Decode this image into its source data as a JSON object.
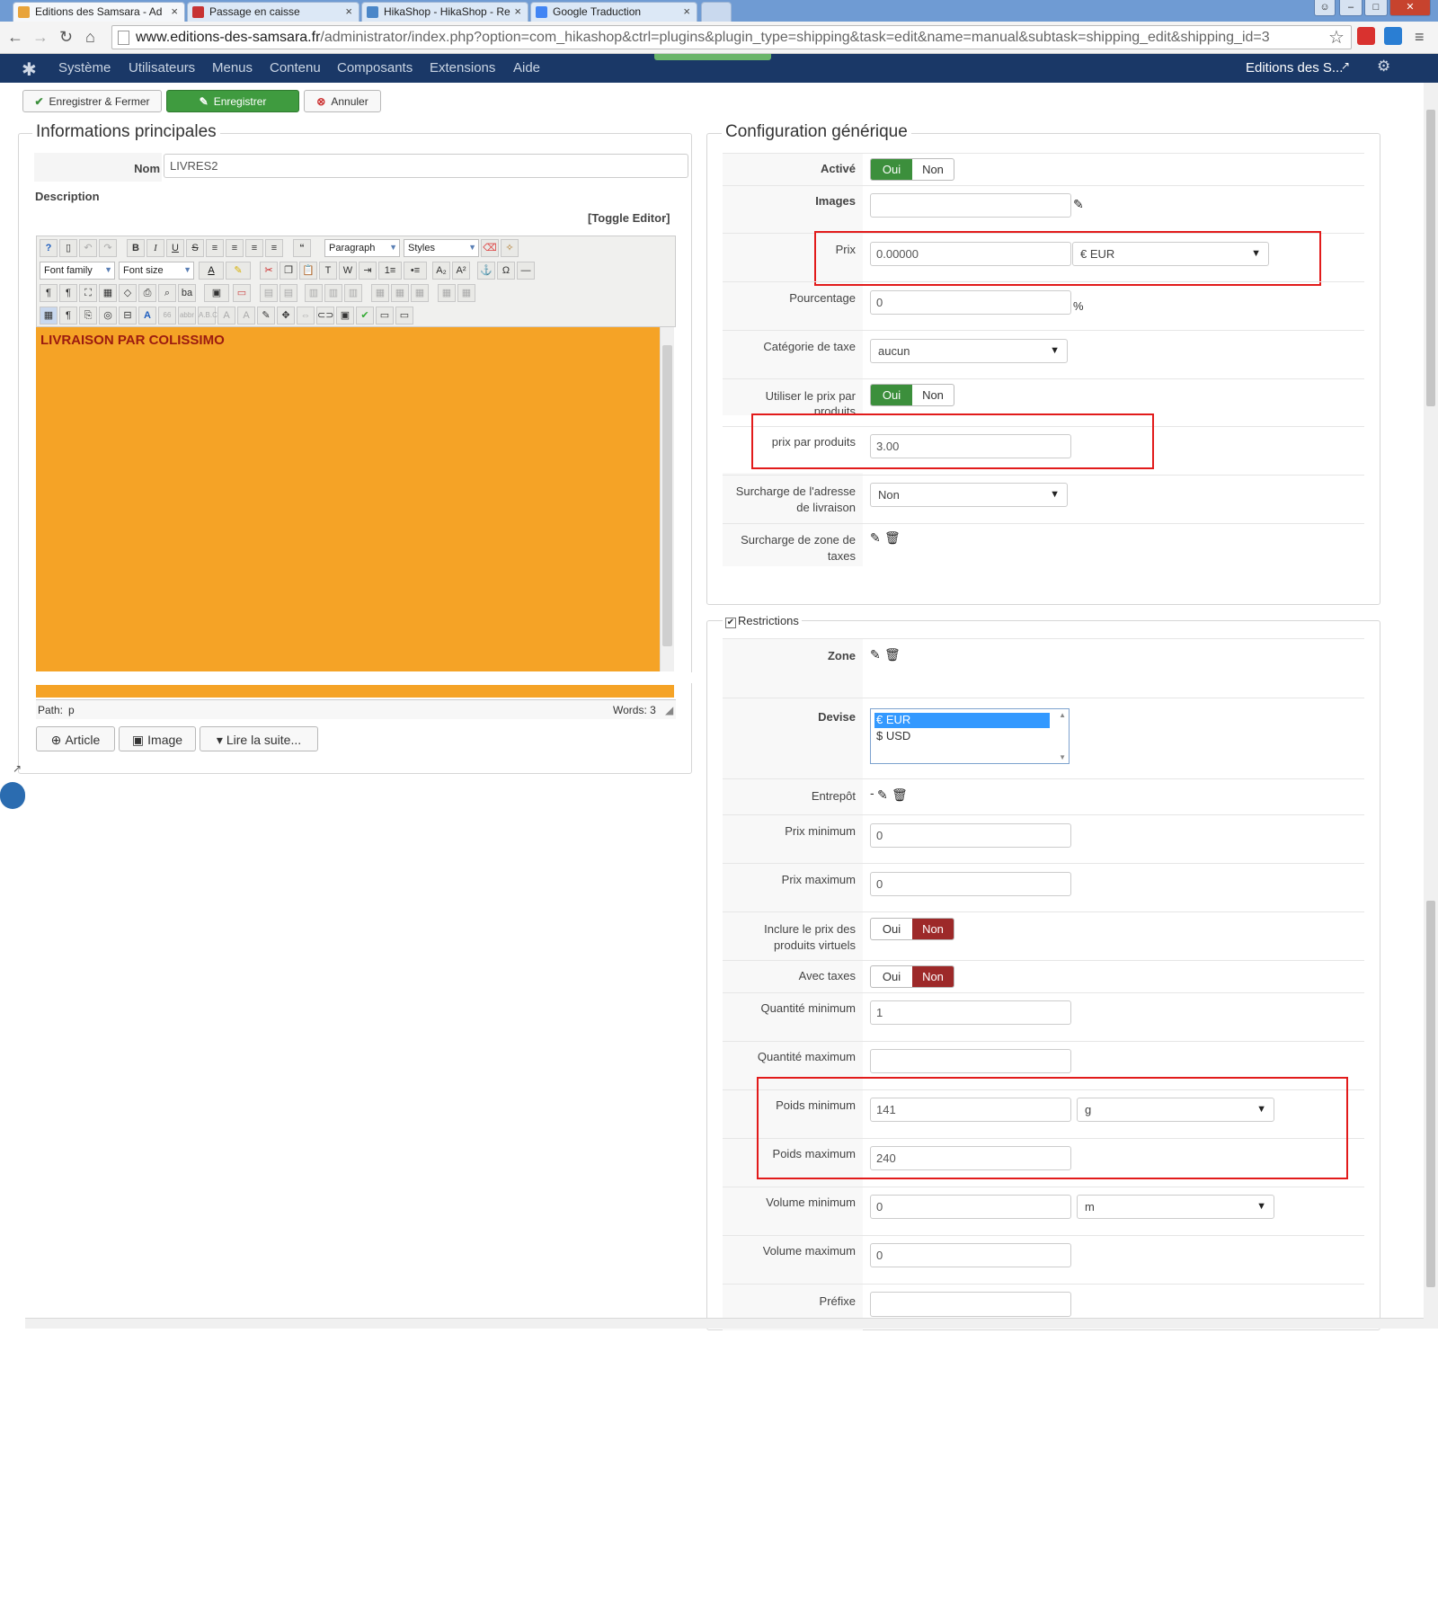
{
  "browser": {
    "tabs": [
      {
        "label": "Editions des Samsara - Ad"
      },
      {
        "label": "Passage en caisse"
      },
      {
        "label": "HikaShop - HikaShop - Re"
      },
      {
        "label": "Google Traduction"
      }
    ],
    "url_host": "www.editions-des-samsara.fr",
    "url_path": "/administrator/index.php?option=com_hikashop&ctrl=plugins&plugin_type=shipping&task=edit&name=manual&subtask=shipping_edit&shipping_id=3"
  },
  "adminmenu": {
    "items": [
      "Système",
      "Utilisateurs",
      "Menus",
      "Contenu",
      "Composants",
      "Extensions",
      "Aide"
    ],
    "site_name": "Editions des S...",
    "gear_glyph": "⚙"
  },
  "toolbar": {
    "save_close": "Enregistrer & Fermer",
    "save": "Enregistrer",
    "cancel": "Annuler"
  },
  "main": {
    "legend": "Informations principales",
    "name_label": "Nom",
    "name_value": "LIVRES2",
    "description_label": "Description",
    "toggle_editor": "[Toggle Editor]",
    "editor": {
      "format_select": "Paragraph",
      "styles_select": "Styles",
      "font_family": "Font family",
      "font_size": "Font size",
      "content": "LIVRAISON PAR COLISSIMO",
      "path_label": "Path:",
      "path_value": "p",
      "words": "Words: 3"
    },
    "buttons": {
      "article": "Article",
      "image": "Image",
      "readmore": "Lire la suite..."
    }
  },
  "config": {
    "legend": "Configuration générique",
    "active_label": "Activé",
    "yes": "Oui",
    "no": "Non",
    "images_label": "Images",
    "price_label": "Prix",
    "price_value": "0.00000",
    "price_currency": "€ EUR",
    "percentage_label": "Pourcentage",
    "percentage_value": "0",
    "percent_sign": "%",
    "tax_category_label": "Catégorie de taxe",
    "tax_category_value": "aucun",
    "use_price_per_product_label": "Utiliser le prix par produits",
    "price_per_product_label": "prix par produits",
    "price_per_product_value": "3.00",
    "override_address_label": "Surcharge de l'adresse de livraison",
    "override_address_value": "Non",
    "override_tax_zone_label": "Surcharge de zone de taxes"
  },
  "restrictions": {
    "legend": "Restrictions",
    "zone_label": "Zone",
    "currency_label": "Devise",
    "currency_options": [
      "€ EUR",
      "$ USD"
    ],
    "warehouse_label": "Entrepôt",
    "warehouse_value": "-",
    "min_price_label": "Prix minimum",
    "min_price_value": "0",
    "max_price_label": "Prix maximum",
    "max_price_value": "0",
    "include_virtual_label": "Inclure le prix des produits virtuels",
    "with_taxes_label": "Avec taxes",
    "min_qty_label": "Quantité minimum",
    "min_qty_value": "1",
    "max_qty_label": "Quantité maximum",
    "max_qty_value": "",
    "min_weight_label": "Poids minimum",
    "min_weight_value": "141",
    "weight_unit": "g",
    "max_weight_label": "Poids maximum",
    "max_weight_value": "240",
    "min_volume_label": "Volume minimum",
    "min_volume_value": "0",
    "volume_unit": "m",
    "max_volume_label": "Volume maximum",
    "max_volume_value": "0",
    "prefix_label": "Préfixe"
  },
  "colors": {
    "accent_green": "#3c8f3c",
    "accent_red": "#9d2929",
    "highlight_box": "#e21b1b",
    "editor_bg": "#f5a326",
    "menu_bg": "#1a3867"
  }
}
